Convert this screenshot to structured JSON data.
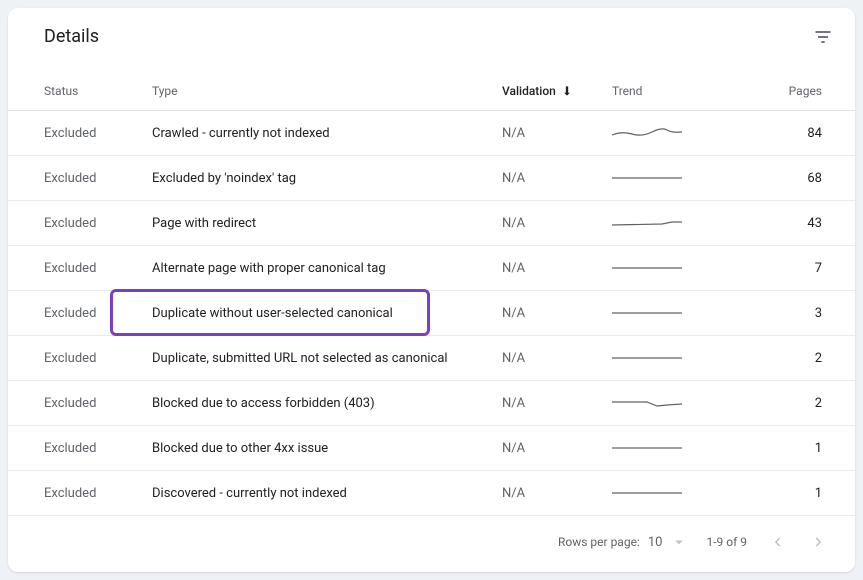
{
  "title": "Details",
  "columns": {
    "status": "Status",
    "type": "Type",
    "validation": "Validation",
    "trend": "Trend",
    "pages": "Pages"
  },
  "sort": {
    "column": "validation",
    "direction": "desc"
  },
  "rows": [
    {
      "status": "Excluded",
      "type": "Crawled - currently not indexed",
      "validation": "N/A",
      "trend": "wavy",
      "pages": "84"
    },
    {
      "status": "Excluded",
      "type": "Excluded by 'noindex' tag",
      "validation": "N/A",
      "trend": "flat",
      "pages": "68"
    },
    {
      "status": "Excluded",
      "type": "Page with redirect",
      "validation": "N/A",
      "trend": "rise",
      "pages": "43"
    },
    {
      "status": "Excluded",
      "type": "Alternate page with proper canonical tag",
      "validation": "N/A",
      "trend": "flat",
      "pages": "7"
    },
    {
      "status": "Excluded",
      "type": "Duplicate without user-selected canonical",
      "validation": "N/A",
      "trend": "flat",
      "pages": "3"
    },
    {
      "status": "Excluded",
      "type": "Duplicate, submitted URL not selected as canonical",
      "validation": "N/A",
      "trend": "flat",
      "pages": "2"
    },
    {
      "status": "Excluded",
      "type": "Blocked due to access forbidden (403)",
      "validation": "N/A",
      "trend": "dip",
      "pages": "2"
    },
    {
      "status": "Excluded",
      "type": "Blocked due to other 4xx issue",
      "validation": "N/A",
      "trend": "flat",
      "pages": "1"
    },
    {
      "status": "Excluded",
      "type": "Discovered - currently not indexed",
      "validation": "N/A",
      "trend": "flat",
      "pages": "1"
    }
  ],
  "highlight_row_index": 4,
  "pagination": {
    "rows_per_page_label": "Rows per page:",
    "rows_per_page_value": "10",
    "range_text": "1-9 of 9"
  }
}
